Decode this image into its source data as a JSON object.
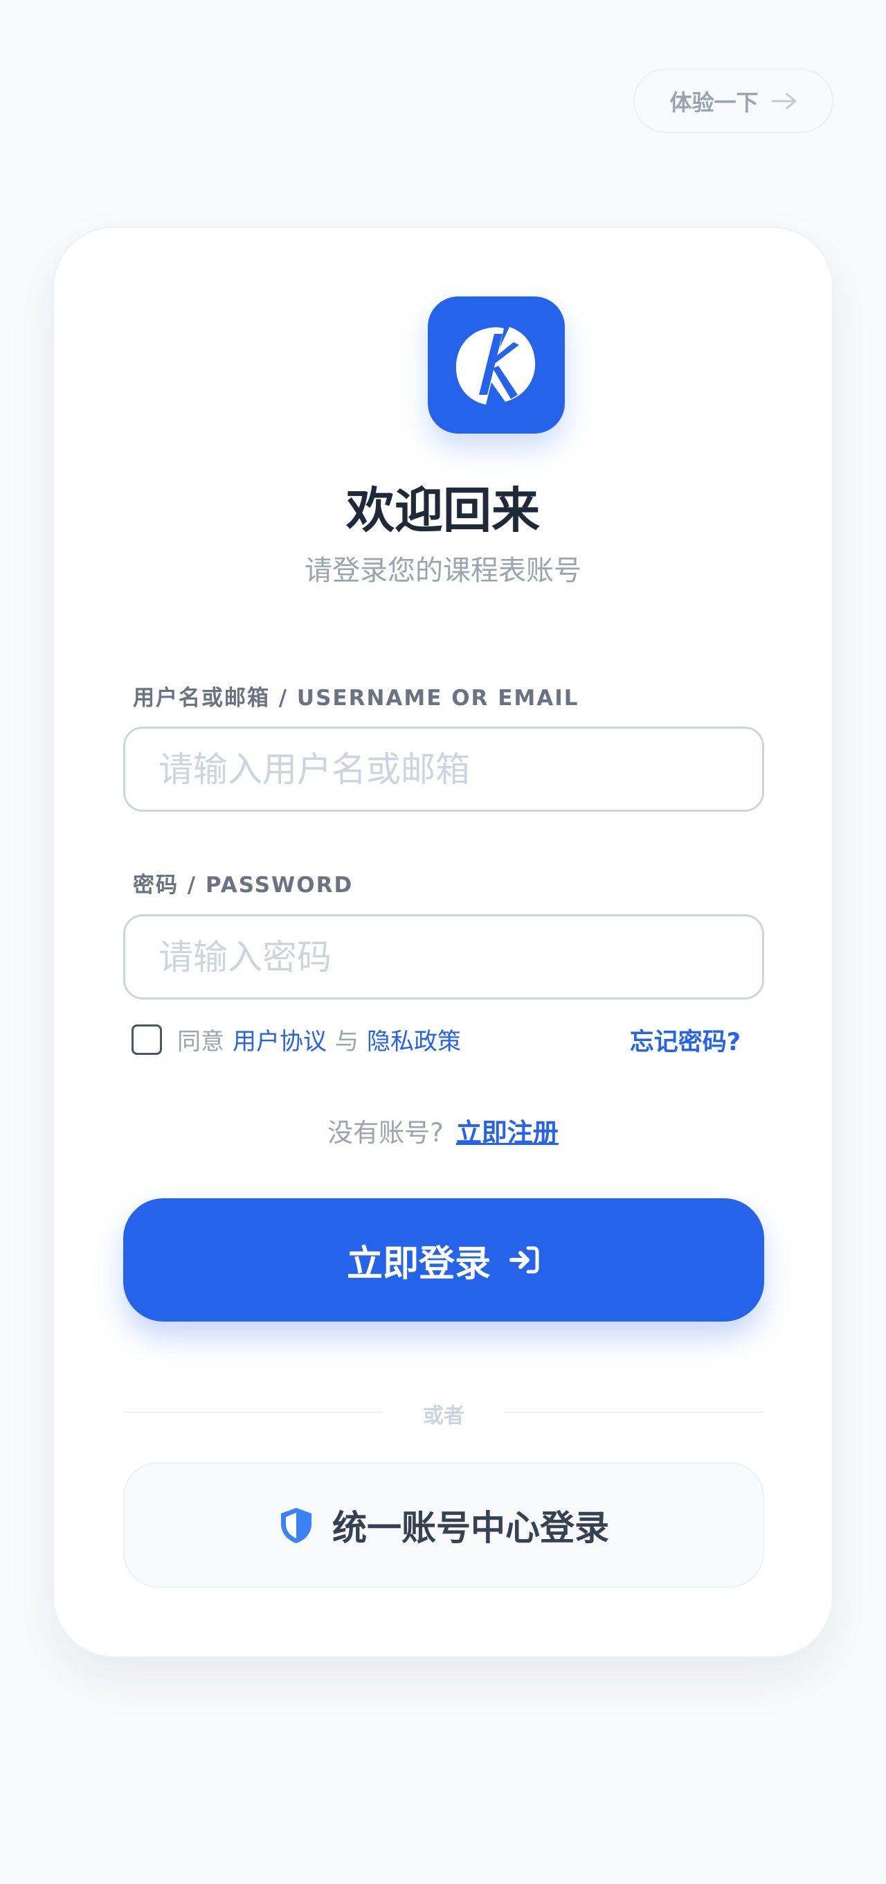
{
  "topbar": {
    "try_label": "体验一下",
    "try_icon": "arrow-right-icon"
  },
  "brand": {
    "logo_icon": "k-logo-icon",
    "accent_color": "#2563eb"
  },
  "header": {
    "title": "欢迎回来",
    "subtitle": "请登录您的课程表账号"
  },
  "form": {
    "username_label": "用户名或邮箱 / USERNAME OR EMAIL",
    "username_placeholder": "请输入用户名或邮箱",
    "username_value": "",
    "password_label": "密码 / PASSWORD",
    "password_placeholder": "请输入密码",
    "password_value": "",
    "agree_checked": false,
    "agree_prefix": "同意",
    "terms_link": "用户协议",
    "agree_and": "与",
    "privacy_link": "隐私政策",
    "forgot_label": "忘记密码?",
    "no_account_text": "没有账号?",
    "register_link": "立即注册",
    "login_label": "立即登录",
    "login_icon": "sign-in-icon",
    "divider_text": "或者",
    "sso_label": "统一账号中心登录",
    "sso_icon": "shield-icon"
  }
}
